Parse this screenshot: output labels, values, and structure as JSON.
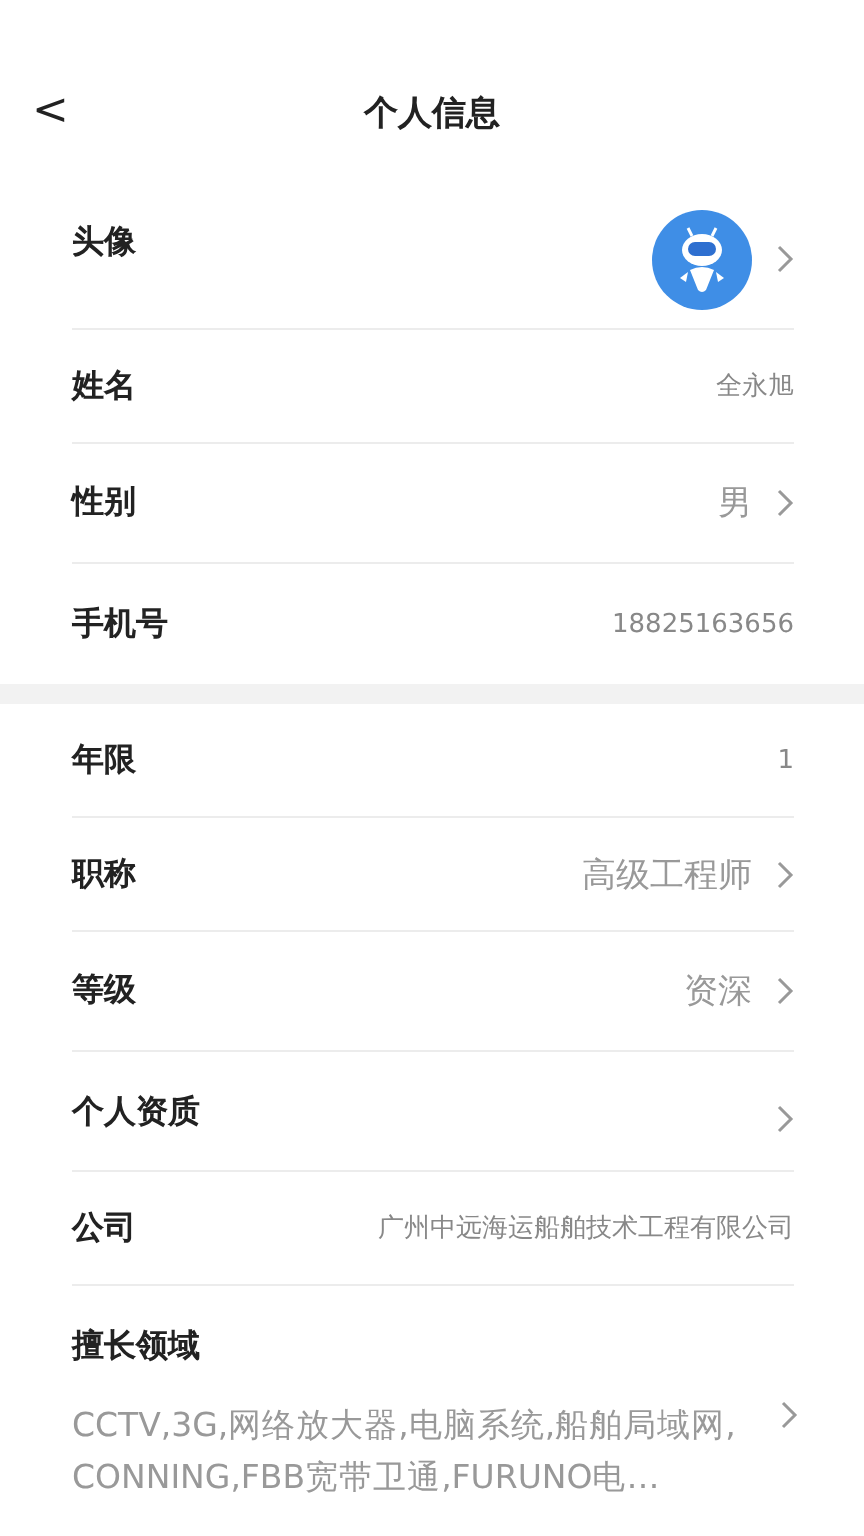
{
  "header": {
    "back": "<",
    "title": "个人信息"
  },
  "sections": [
    {
      "rows": [
        {
          "kind": "avatar",
          "label": "头像"
        },
        {
          "kind": "info",
          "label": "姓名",
          "value": "全永旭"
        },
        {
          "kind": "link",
          "label": "性别",
          "value": "男"
        },
        {
          "kind": "info",
          "label": "手机号",
          "value": "18825163656"
        }
      ]
    },
    {
      "rows": [
        {
          "kind": "info",
          "label": "年限",
          "value": "1"
        },
        {
          "kind": "link",
          "label": "职称",
          "value": "高级工程师"
        },
        {
          "kind": "link",
          "label": "等级",
          "value": "资深"
        },
        {
          "kind": "tall",
          "label": "个人资质"
        },
        {
          "kind": "info",
          "label": "公司",
          "value": "广州中远海运船舶技术工程有限公司"
        },
        {
          "kind": "multiline",
          "label": "擅长领域",
          "value": "CCTV,3G,网络放大器,电脑系统,船舶局域网,CONNING,FBB宽带卫通,FURUNO电…"
        }
      ]
    }
  ]
}
